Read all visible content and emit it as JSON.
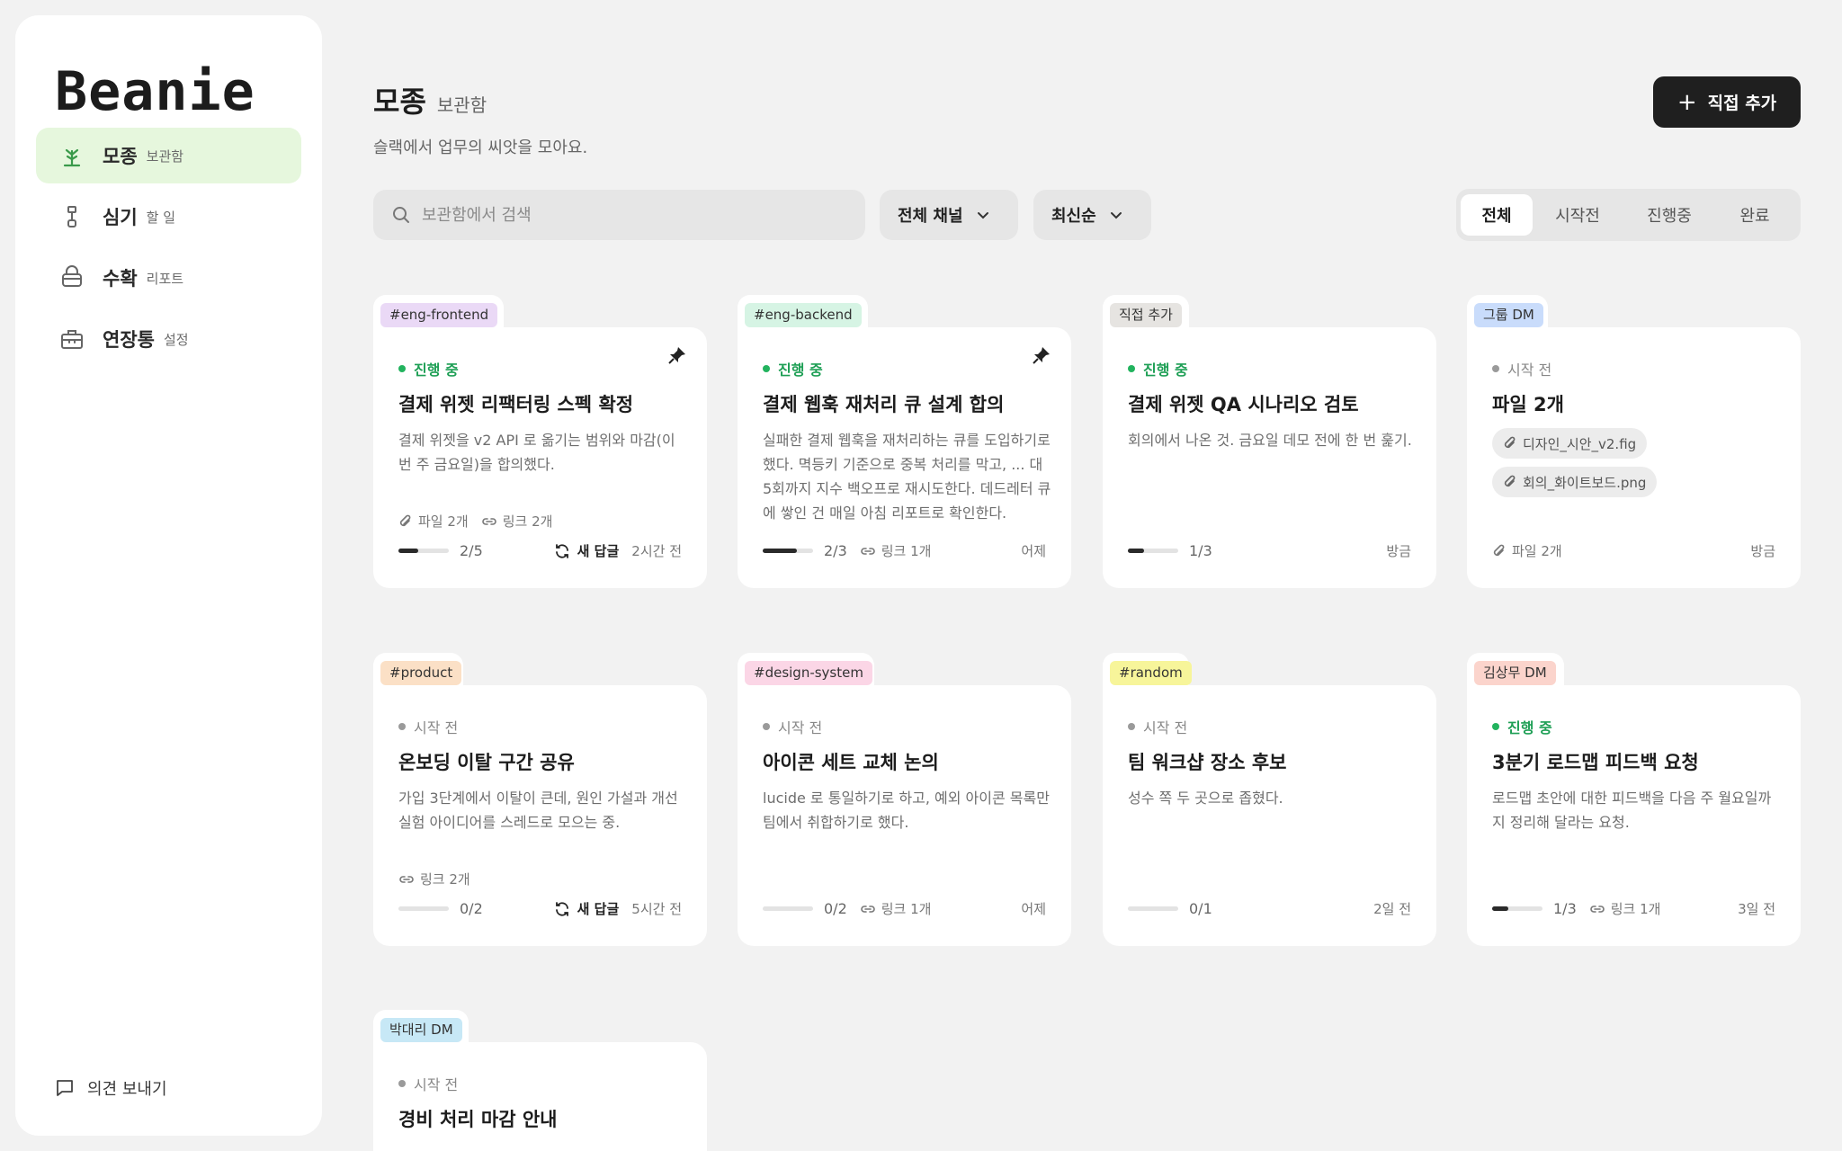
{
  "app": {
    "logo": "Beanie"
  },
  "sidebar": {
    "items": [
      {
        "label": "모종",
        "sub": "보관함",
        "active": true
      },
      {
        "label": "심기",
        "sub": "할 일",
        "active": false
      },
      {
        "label": "수확",
        "sub": "리포트",
        "active": false
      },
      {
        "label": "연장통",
        "sub": "설정",
        "active": false
      }
    ],
    "feedback": "의견 보내기"
  },
  "header": {
    "title": "모종",
    "subtitle": "보관함",
    "description": "슬랙에서 업무의 씨앗을 모아요.",
    "add_button": "직접 추가"
  },
  "toolbar": {
    "search_placeholder": "보관함에서 검색",
    "channel_filter": "전체 채널",
    "sort": "최신순",
    "tabs": [
      "전체",
      "시작전",
      "진행중",
      "완료"
    ],
    "active_tab": "전체"
  },
  "colors": {
    "active_status": "#22b35e",
    "nav_active_bg": "#e6f7dd",
    "primary_button": "#1f1f1f"
  },
  "cards": [
    {
      "tag": "#eng-frontend",
      "tag_color": "#ead9f6",
      "status": "진행 중",
      "title": "결제 위젯 리팩터링 스펙 확정",
      "desc": "결제 위젯을 v2 API 로 옮기는 범위와 마감(이번 주 금요일)을 합의했다.",
      "files": "파일 2개",
      "links": "링크 2개",
      "progress": "2/5",
      "reply": "새 답글",
      "time": "2시간 전"
    },
    {
      "tag": "#eng-backend",
      "tag_color": "#d6f4e4",
      "status": "진행 중",
      "title": "결제 웹훅 재처리 큐 설계 합의",
      "desc": "실패한 결제 웹훅을 재처리하는 큐를 도입하기로 했다. 멱등키 기준으로 중복 처리를 막고, ... 대 5회까지 지수 백오프로 재시도한다. 데드레터 큐에 쌓인 건 매일 아침 리포트로 확인한다.",
      "progress": "2/3",
      "links": "링크 1개",
      "time": "어제"
    },
    {
      "tag": "직접 추가",
      "tag_color": "#e6e4e1",
      "status": "진행 중",
      "title": "결제 위젯 QA 시나리오 검토",
      "desc": "회의에서 나온 것. 금요일 데모 전에 한 번 훑기.",
      "progress": "1/3",
      "time": "방금"
    },
    {
      "tag": "그룹 DM",
      "tag_color": "#c9dcfb",
      "status": "시작 전",
      "title": "파일 2개",
      "attachments": [
        "디자인_시안_v2.fig",
        "회의_화이트보드.png"
      ],
      "files": "파일 2개",
      "time": "방금"
    },
    {
      "tag": "#product",
      "tag_color": "#fbe0c6",
      "status": "시작 전",
      "title": "온보딩 이탈 구간 공유",
      "desc": "가입 3단계에서 이탈이 큰데, 원인 가설과 개선 실험 아이디어를 스레드로 모으는 중.",
      "links": "링크 2개",
      "progress": "0/2",
      "reply": "새 답글",
      "time": "5시간 전"
    },
    {
      "tag": "#design-system",
      "tag_color": "#fbd6e6",
      "status": "시작 전",
      "title": "아이콘 세트 교체 논의",
      "desc": "lucide 로 통일하기로 하고, 예외 아이콘 목록만 팀에서 취합하기로 했다.",
      "progress": "0/2",
      "links": "링크 1개",
      "time": "어제"
    },
    {
      "tag": "#random",
      "tag_color": "#f7f59a",
      "status": "시작 전",
      "title": "팀 워크샵 장소 후보",
      "desc": "성수 쪽 두 곳으로 좁혔다.",
      "progress": "0/1",
      "time": "2일 전"
    },
    {
      "tag": "김상무 DM",
      "tag_color": "#fbd4cc",
      "status": "진행 중",
      "title": "3분기 로드맵 피드백 요청",
      "desc": "로드맵 초안에 대한 피드백을 다음 주 월요일까지 정리해 달라는 요청.",
      "progress": "1/3",
      "links": "링크 1개",
      "time": "3일 전"
    },
    {
      "tag": "박대리 DM",
      "tag_color": "#c7e8f6",
      "status": "시작 전",
      "title": "경비 처리 마감 안내"
    }
  ]
}
